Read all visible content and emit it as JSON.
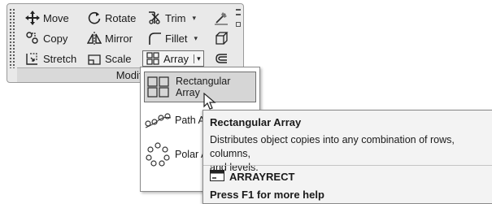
{
  "panel": {
    "title": "Modify",
    "tools": {
      "move": {
        "label": "Move",
        "icon": "move-icon"
      },
      "rotate": {
        "label": "Rotate",
        "icon": "rotate-icon"
      },
      "trim": {
        "label": "Trim",
        "icon": "trim-icon"
      },
      "copy": {
        "label": "Copy",
        "icon": "copy-icon"
      },
      "mirror": {
        "label": "Mirror",
        "icon": "mirror-icon"
      },
      "fillet": {
        "label": "Fillet",
        "icon": "fillet-icon"
      },
      "stretch": {
        "label": "Stretch",
        "icon": "stretch-icon"
      },
      "scale": {
        "label": "Scale",
        "icon": "scale-icon"
      },
      "array": {
        "label": "Array",
        "icon": "array-icon"
      }
    },
    "caret": "▾"
  },
  "dropdown": {
    "items": [
      {
        "label": "Rectangular Array",
        "icon": "rectangular-array-icon",
        "selected": true
      },
      {
        "label": "Path A",
        "icon": "path-array-icon"
      },
      {
        "label": "Polar A",
        "icon": "polar-array-icon"
      }
    ]
  },
  "tooltip": {
    "title": "Rectangular Array",
    "description": "Distributes object copies into any combination of rows, columns,\nand levels.",
    "command": "ARRAYRECT",
    "help": "Press F1 for more help"
  }
}
